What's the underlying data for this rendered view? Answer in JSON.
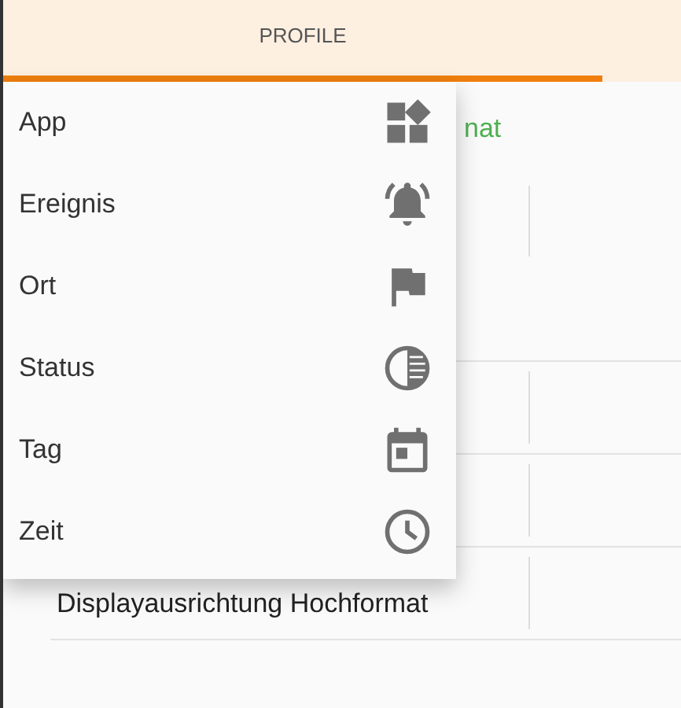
{
  "tabs": [
    {
      "label": "PROFILE",
      "selected": true
    }
  ],
  "header": {
    "text": "nat"
  },
  "rows": [
    {
      "text": "Displayausrichtung Hochformat"
    }
  ],
  "menu": {
    "items": [
      {
        "label": "App"
      },
      {
        "label": "Ereignis"
      },
      {
        "label": "Ort"
      },
      {
        "label": "Status"
      },
      {
        "label": "Tag"
      },
      {
        "label": "Zeit"
      }
    ]
  }
}
